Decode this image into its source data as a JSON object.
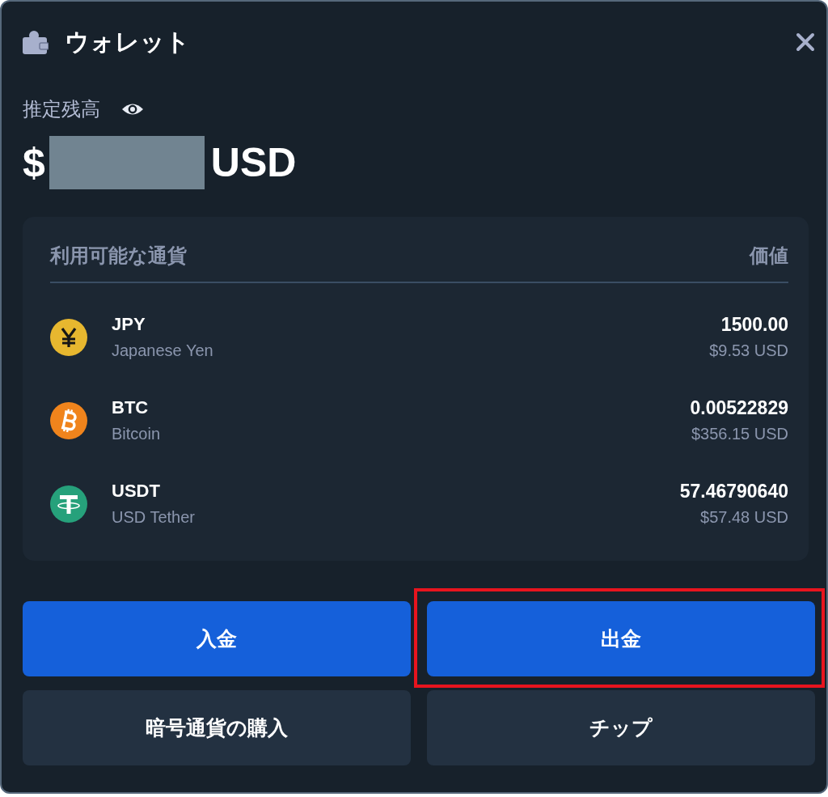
{
  "window": {
    "title": "ウォレット"
  },
  "balance": {
    "label": "推定残高",
    "prefix": "$",
    "redacted": true,
    "currency": "USD"
  },
  "currencies": {
    "columns": [
      "利用可能な通貨",
      "価値"
    ],
    "rows": [
      {
        "kind": "yen",
        "code": "JPY",
        "name": "Japanese Yen",
        "amount": "1500.00",
        "usd_value": "$9.53 USD"
      },
      {
        "kind": "bitcoin",
        "code": "BTC",
        "name": "Bitcoin",
        "amount": "0.00522829",
        "usd_value": "$356.15 USD"
      },
      {
        "kind": "tether",
        "code": "USDT",
        "name": "USD Tether",
        "amount": "57.46790640",
        "usd_value": "$57.48 USD"
      }
    ]
  },
  "buttons": [
    {
      "label": "入金",
      "kind": "primary",
      "highlighted": false
    },
    {
      "label": "出金",
      "kind": "primary",
      "highlighted": true
    },
    {
      "label": "暗号通貨の購入",
      "kind": "secondary",
      "highlighted": false
    },
    {
      "label": "チップ",
      "kind": "secondary",
      "highlighted": false
    }
  ]
}
